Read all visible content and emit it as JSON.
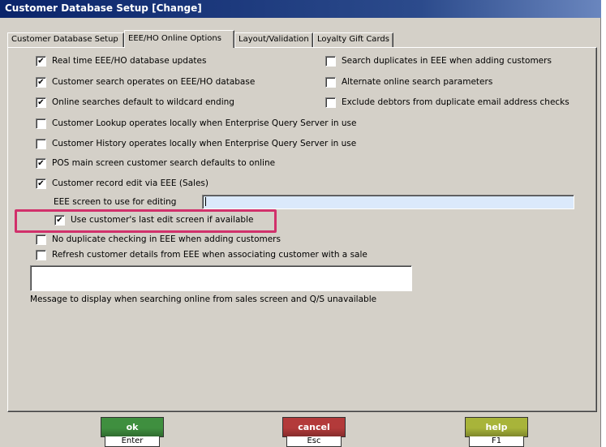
{
  "window": {
    "title": "Customer Database Setup  [Change]"
  },
  "tabs": [
    {
      "label": "Customer Database Setup",
      "active": false
    },
    {
      "label": "EEE/HO Online Options",
      "active": true
    },
    {
      "label": "Layout/Validation",
      "active": false
    },
    {
      "label": "Loyalty Gift Cards",
      "active": false
    }
  ],
  "options": {
    "realtime_updates": {
      "label": "Real time EEE/HO database updates",
      "checked": true
    },
    "search_on_eee": {
      "label": "Customer search operates on EEE/HO database",
      "checked": true
    },
    "wildcard_ending": {
      "label": "Online searches default to wildcard ending",
      "checked": true
    },
    "lookup_local": {
      "label": "Customer Lookup operates locally when Enterprise Query Server in use",
      "checked": false
    },
    "history_local": {
      "label": "Customer History operates locally when Enterprise Query Server in use",
      "checked": false
    },
    "pos_search_online": {
      "label": "POS main screen customer search defaults to online",
      "checked": true
    },
    "record_edit_eee": {
      "label": "Customer record edit via EEE (Sales)",
      "checked": true
    },
    "use_last_edit_screen": {
      "label": "Use customer's last edit screen if available",
      "checked": true
    },
    "no_duplicate_check": {
      "label": "No duplicate checking in EEE when adding customers",
      "checked": false
    },
    "refresh_details": {
      "label": "Refresh customer details from EEE when associating customer with a sale",
      "checked": false
    },
    "search_duplicates": {
      "label": "Search duplicates in EEE when adding customers",
      "checked": false
    },
    "alternate_params": {
      "label": "Alternate online search parameters",
      "checked": false
    },
    "exclude_debtors": {
      "label": "Exclude debtors from duplicate email address checks",
      "checked": false
    }
  },
  "edit_screen": {
    "label": "EEE screen to use for editing",
    "value": ""
  },
  "message": {
    "label": "Message to display when searching online from sales screen and Q/S unavailable",
    "value": ""
  },
  "buttons": {
    "ok": {
      "label": "ok",
      "key": "Enter",
      "color": "#3f8f3f"
    },
    "cancel": {
      "label": "cancel",
      "key": "Esc",
      "color": "#b33a3a"
    },
    "help": {
      "label": "help",
      "key": "F1",
      "color": "#a8b43a"
    }
  },
  "highlight_color": "#d1306b"
}
